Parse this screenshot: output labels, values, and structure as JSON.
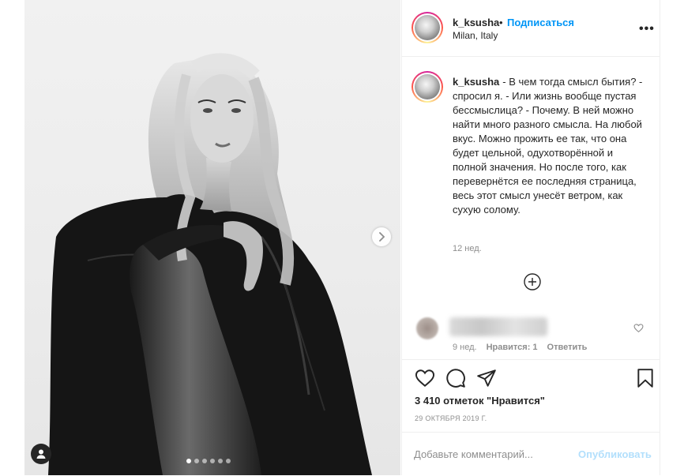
{
  "post": {
    "image_alt": "Black and white photo of a blonde woman in a dark jacket",
    "carousel": {
      "count": 6,
      "active_index": 0
    }
  },
  "header": {
    "username": "k_ksusha",
    "separator": "•",
    "follow_label": "Подписаться",
    "location": "Milan, Italy",
    "more_label": "•••"
  },
  "caption": {
    "username": "k_ksusha",
    "text": "- В чем тогда смысл бытия? - спросил я. - Или жизнь вообще пустая бессмыслица? - Почему. В ней можно найти много разного смысла. На любой вкус. Можно прожить ее так, что она будет цельной, одухотворённой и полной значения. Но после того, как перевернётся ее последняя страница, весь этот смысл унесёт ветром, как сухую солому.",
    "time": "12 нед."
  },
  "comment": {
    "time": "9 нед.",
    "likes_label": "Нравится: 1",
    "reply_label": "Ответить"
  },
  "footer": {
    "likes": "3 410 отметок \"Нравится\"",
    "date": "29 ОКТЯБРЯ 2019 Г.",
    "add_comment_placeholder": "Добавьте комментарий...",
    "publish_label": "Опубликовать"
  },
  "colors": {
    "link_blue": "#0095f6",
    "publish_disabled": "#b2dffc",
    "muted": "#8e8e8e",
    "text": "#262626"
  }
}
